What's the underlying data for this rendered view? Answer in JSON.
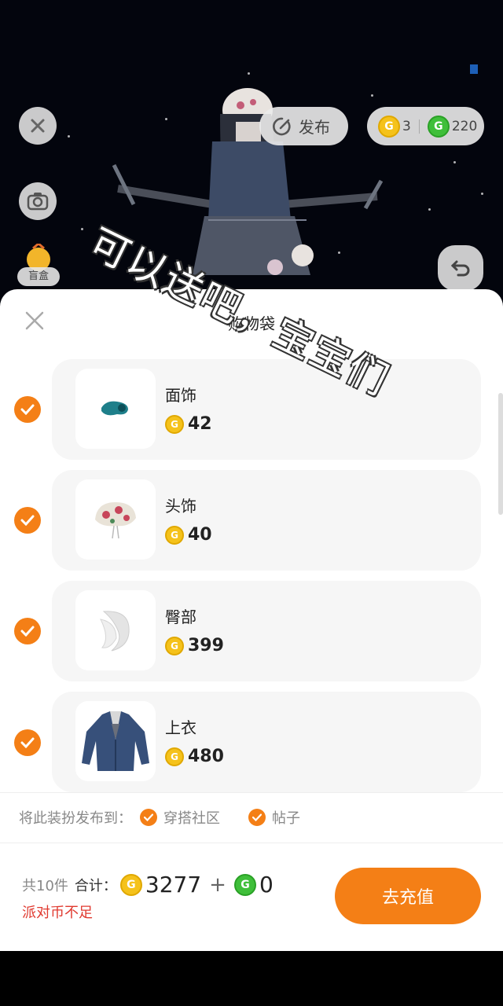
{
  "overlay_caption": "可以送吧，宝宝们",
  "topbar": {
    "publish_label": "发布",
    "gold_coins": "3",
    "green_coins": "220"
  },
  "blindbox": {
    "label": "盲盒"
  },
  "cart": {
    "title": "购物袋",
    "items": [
      {
        "name": "面饰",
        "price": "42",
        "checked": true
      },
      {
        "name": "头饰",
        "price": "40",
        "checked": true
      },
      {
        "name": "臀部",
        "price": "399",
        "checked": true
      },
      {
        "name": "上衣",
        "price": "480",
        "checked": true
      }
    ]
  },
  "publish": {
    "label": "将此装扮发布到：",
    "options": [
      {
        "label": "穿搭社区",
        "checked": true
      },
      {
        "label": "帖子",
        "checked": true
      }
    ]
  },
  "summary": {
    "count_label": "共10件",
    "total_label": "合计：",
    "gold_total": "3277",
    "plus": "+",
    "green_total": "0",
    "warning": "派对币不足",
    "recharge_label": "去充值"
  },
  "colors": {
    "accent": "#f47f16",
    "warning": "#e0392f",
    "gold": "#f5c21b",
    "green": "#3fbf3a"
  }
}
